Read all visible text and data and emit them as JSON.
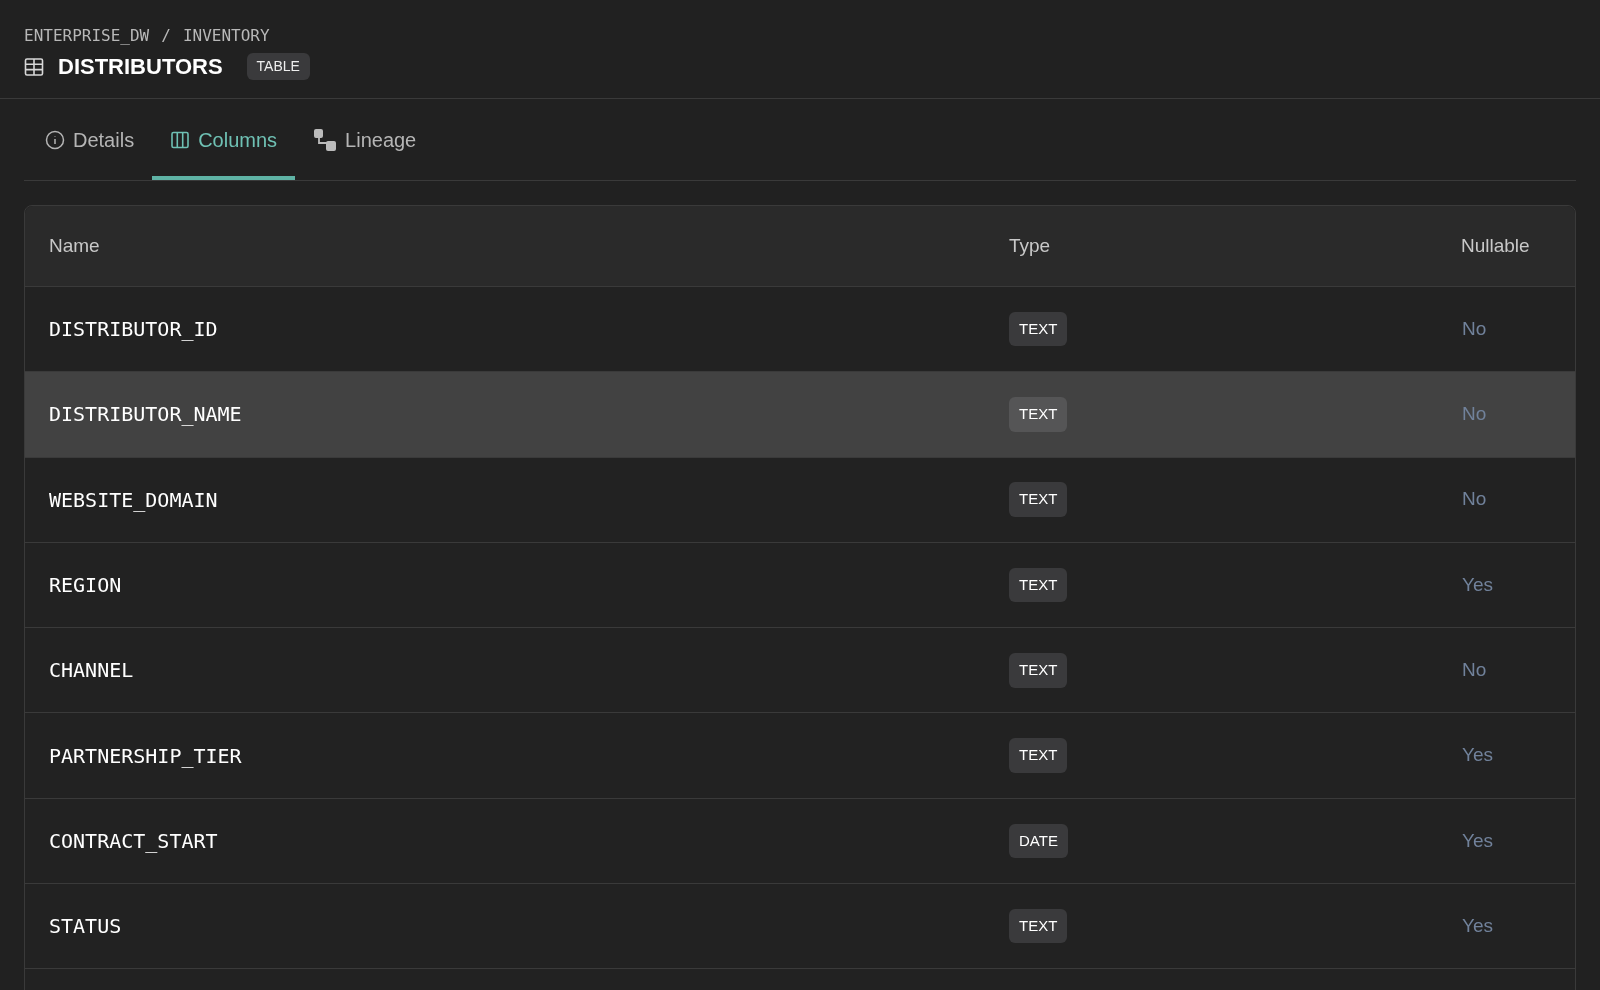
{
  "breadcrumb": [
    "ENTERPRISE_DW",
    "INVENTORY"
  ],
  "breadcrumb_separator": "/",
  "title": "DISTRIBUTORS",
  "object_type": "TABLE",
  "tabs": [
    {
      "label": "Details",
      "kind": "info",
      "selected": false
    },
    {
      "label": "Columns",
      "kind": "columns",
      "selected": true
    },
    {
      "label": "Lineage",
      "kind": "lineage",
      "selected": false
    }
  ],
  "table": {
    "columns": [
      "Name",
      "Type",
      "Nullable"
    ],
    "rows": [
      {
        "name": "DISTRIBUTOR_ID",
        "type": "TEXT",
        "nullable": "No",
        "selected": false
      },
      {
        "name": "DISTRIBUTOR_NAME",
        "type": "TEXT",
        "nullable": "No",
        "selected": true
      },
      {
        "name": "WEBSITE_DOMAIN",
        "type": "TEXT",
        "nullable": "No",
        "selected": false
      },
      {
        "name": "REGION",
        "type": "TEXT",
        "nullable": "Yes",
        "selected": false
      },
      {
        "name": "CHANNEL",
        "type": "TEXT",
        "nullable": "No",
        "selected": false
      },
      {
        "name": "PARTNERSHIP_TIER",
        "type": "TEXT",
        "nullable": "Yes",
        "selected": false
      },
      {
        "name": "CONTRACT_START",
        "type": "DATE",
        "nullable": "Yes",
        "selected": false
      },
      {
        "name": "STATUS",
        "type": "TEXT",
        "nullable": "Yes",
        "selected": false
      }
    ]
  }
}
